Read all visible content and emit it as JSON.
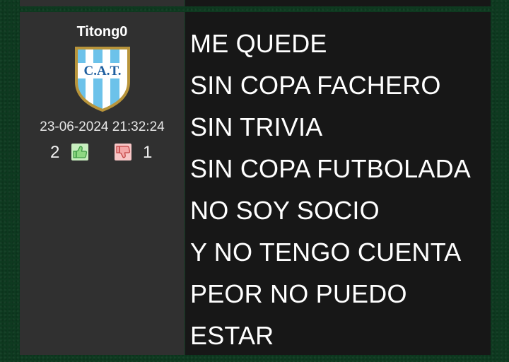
{
  "post": {
    "username": "Titong0",
    "avatar_badge": "C.A.T.",
    "timestamp": "23-06-2024 21:32:24",
    "likes": "2",
    "dislikes": "1",
    "icons": {
      "like": "thumbs-up-icon",
      "dislike": "thumbs-down-icon"
    },
    "colors": {
      "background": "#0e3a20",
      "author_panel": "#303030",
      "message_panel": "#171717",
      "like_button": "#c8efbf",
      "dislike_button": "#f7c6c6",
      "badge_blue": "#6cc2ea"
    },
    "lines": [
      "ME QUEDE",
      "SIN COPA FACHERO",
      "SIN TRIVIA",
      "SIN COPA FUTBOLADA",
      "NO SOY SOCIO",
      "Y NO TENGO CUENTA",
      "PEOR NO PUEDO",
      "ESTAR"
    ]
  }
}
